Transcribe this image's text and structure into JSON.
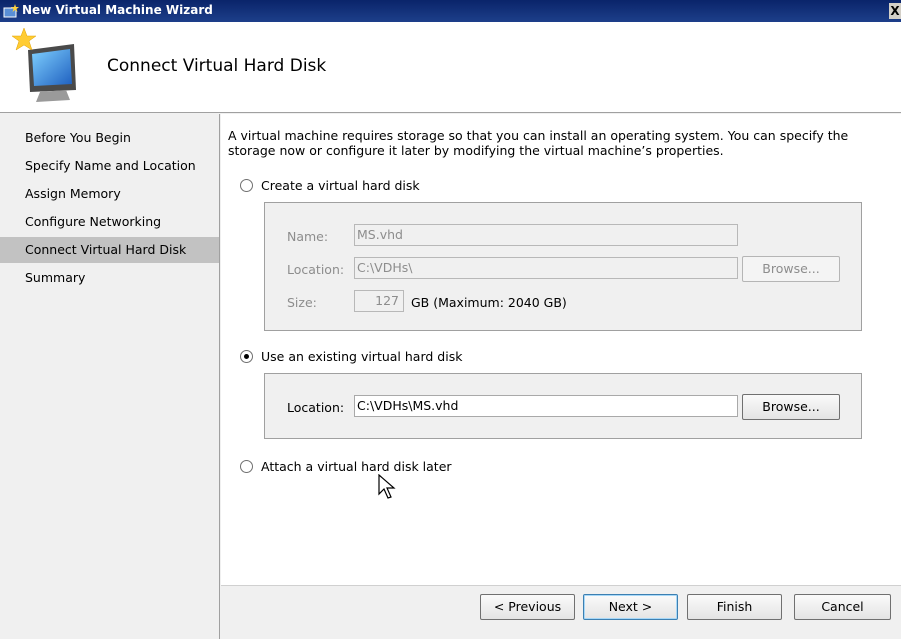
{
  "window": {
    "title": "New Virtual Machine Wizard",
    "close_glyph": "X"
  },
  "header": {
    "title": "Connect Virtual Hard Disk",
    "icon": "monitor-with-star-icon"
  },
  "sidebar": {
    "items": [
      {
        "label": "Before You Begin",
        "active": false
      },
      {
        "label": "Specify Name and Location",
        "active": false
      },
      {
        "label": "Assign Memory",
        "active": false
      },
      {
        "label": "Configure Networking",
        "active": false
      },
      {
        "label": "Connect Virtual Hard Disk",
        "active": true
      },
      {
        "label": "Summary",
        "active": false
      }
    ]
  },
  "main": {
    "intro": "A virtual machine requires storage so that you can install an operating system. You can specify the storage now or configure it later by modifying the virtual machine’s properties.",
    "option_create": {
      "label": "Create a virtual hard disk",
      "selected": false,
      "name_label": "Name:",
      "name_value": "MS.vhd",
      "location_label": "Location:",
      "location_value": "C:\\VDHs\\",
      "browse_label": "Browse...",
      "size_label": "Size:",
      "size_value": "127",
      "size_suffix": "GB (Maximum: 2040 GB)"
    },
    "option_existing": {
      "label": "Use an existing virtual hard disk",
      "selected": true,
      "location_label": "Location:",
      "location_value": "C:\\VDHs\\MS.vhd",
      "browse_label": "Browse..."
    },
    "option_later": {
      "label": "Attach a virtual hard disk later",
      "selected": false
    }
  },
  "footer": {
    "previous_label": "< Previous",
    "next_label": "Next >",
    "finish_label": "Finish",
    "cancel_label": "Cancel"
  }
}
